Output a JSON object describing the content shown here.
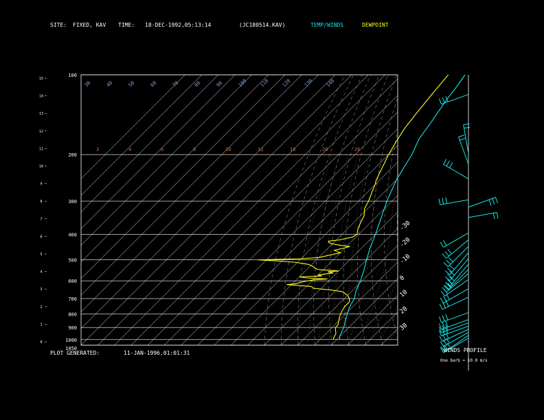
{
  "header": {
    "site_label": "SITE:",
    "site_value": "FIXED, KAV",
    "time_label": "TIME:",
    "time_value": "18-DEC-1992,05:13:14",
    "file_id": "(JC180514.KAV)",
    "legend_temp": "TEMP/WINDS",
    "legend_dew": "DEWPOINT",
    "legend_temp_color": "#19e6e6",
    "legend_dew_color": "#ffff19"
  },
  "footer": {
    "generated_label": "PLOT GENERATED:",
    "generated_value": "11-JAN-1996,01:01:31"
  },
  "winds_panel": {
    "title": "WINDS PROFILE",
    "note": "One barb = 10.0 m/s"
  },
  "chart_data": {
    "type": "line",
    "diagram": "skew-T log-p",
    "pressure_levels": [
      100,
      200,
      300,
      400,
      500,
      600,
      700,
      800,
      900,
      1000,
      1050
    ],
    "pressure_labels": [
      "100",
      "200",
      "300",
      "400",
      "500",
      "600",
      "700",
      "800",
      "900",
      "1000",
      "1050"
    ],
    "height_km_ticks": [
      "0",
      "1",
      "2",
      "3",
      "4",
      "5",
      "6",
      "7",
      "8",
      "9",
      "10",
      "11",
      "12",
      "13",
      "14",
      "15"
    ],
    "temperature_top_labels": [
      "-110",
      "-100",
      "-90",
      "-80",
      "-70",
      "-60",
      "-50",
      "-40"
    ],
    "temperature_right_labels": [
      "-30",
      "-20",
      "-10",
      "0",
      "10",
      "20",
      "30"
    ],
    "isotherm_range_c": [
      -150,
      40
    ],
    "mixing_ratio_labels": [
      "3",
      "4",
      "6",
      "8",
      "10",
      "12",
      "16",
      "20",
      "26"
    ],
    "theta_labels": [
      "30",
      "40",
      "50",
      "60",
      "70",
      "80",
      "90",
      "100",
      "110",
      "120",
      "130",
      "140"
    ],
    "series": [
      {
        "name": "TEMP/WINDS",
        "color": "#19e6e6",
        "points": [
          [
            1000,
            2
          ],
          [
            975,
            0
          ],
          [
            950,
            -1
          ],
          [
            925,
            -2
          ],
          [
            900,
            -3
          ],
          [
            850,
            -6
          ],
          [
            800,
            -9
          ],
          [
            750,
            -12
          ],
          [
            700,
            -14
          ],
          [
            650,
            -18
          ],
          [
            600,
            -21
          ],
          [
            550,
            -25
          ],
          [
            500,
            -30
          ],
          [
            450,
            -35
          ],
          [
            400,
            -40
          ],
          [
            350,
            -46
          ],
          [
            300,
            -53
          ],
          [
            250,
            -60
          ],
          [
            200,
            -66
          ],
          [
            175,
            -71
          ],
          [
            150,
            -74
          ],
          [
            125,
            -78
          ],
          [
            110,
            -80
          ],
          [
            100,
            -82
          ]
        ]
      },
      {
        "name": "DEWPOINT",
        "color": "#ffff19",
        "points": [
          [
            1000,
            -2
          ],
          [
            980,
            -3
          ],
          [
            950,
            -4
          ],
          [
            925,
            -6
          ],
          [
            900,
            -8
          ],
          [
            880,
            -8
          ],
          [
            850,
            -10
          ],
          [
            820,
            -12
          ],
          [
            800,
            -13
          ],
          [
            780,
            -14
          ],
          [
            750,
            -15
          ],
          [
            720,
            -15
          ],
          [
            700,
            -17
          ],
          [
            680,
            -20
          ],
          [
            660,
            -25
          ],
          [
            650,
            -33
          ],
          [
            640,
            -45
          ],
          [
            630,
            -47
          ],
          [
            625,
            -55
          ],
          [
            620,
            -63
          ],
          [
            615,
            -58
          ],
          [
            605,
            -55
          ],
          [
            595,
            -50
          ],
          [
            590,
            -42
          ],
          [
            585,
            -55
          ],
          [
            580,
            -60
          ],
          [
            575,
            -47
          ],
          [
            570,
            -50
          ],
          [
            560,
            -42
          ],
          [
            555,
            -46
          ],
          [
            550,
            -40
          ],
          [
            545,
            -52
          ],
          [
            540,
            -55
          ],
          [
            530,
            -58
          ],
          [
            520,
            -62
          ],
          [
            510,
            -72
          ],
          [
            505,
            -82
          ],
          [
            500,
            -95
          ],
          [
            495,
            -70
          ],
          [
            490,
            -60
          ],
          [
            480,
            -55
          ],
          [
            470,
            -50
          ],
          [
            460,
            -55
          ],
          [
            450,
            -50
          ],
          [
            445,
            -48
          ],
          [
            440,
            -55
          ],
          [
            435,
            -60
          ],
          [
            430,
            -63
          ],
          [
            425,
            -64
          ],
          [
            420,
            -58
          ],
          [
            410,
            -52
          ],
          [
            400,
            -51
          ],
          [
            380,
            -54
          ],
          [
            360,
            -56
          ],
          [
            340,
            -58
          ],
          [
            320,
            -62
          ],
          [
            300,
            -64
          ],
          [
            280,
            -67
          ],
          [
            260,
            -70
          ],
          [
            250,
            -72
          ],
          [
            230,
            -75
          ],
          [
            200,
            -80
          ],
          [
            180,
            -83
          ],
          [
            160,
            -86
          ],
          [
            140,
            -88
          ],
          [
            120,
            -90
          ],
          [
            110,
            -91
          ],
          [
            100,
            -92
          ]
        ]
      }
    ],
    "winds": [
      [
        1000,
        240,
        20
      ],
      [
        975,
        235,
        25
      ],
      [
        950,
        240,
        30
      ],
      [
        925,
        245,
        30
      ],
      [
        900,
        250,
        35
      ],
      [
        875,
        250,
        35
      ],
      [
        850,
        250,
        30
      ],
      [
        800,
        250,
        30
      ],
      [
        700,
        245,
        30
      ],
      [
        650,
        240,
        25
      ],
      [
        600,
        235,
        20
      ],
      [
        570,
        230,
        25
      ],
      [
        550,
        225,
        30
      ],
      [
        525,
        220,
        30
      ],
      [
        500,
        220,
        30
      ],
      [
        475,
        220,
        30
      ],
      [
        450,
        225,
        25
      ],
      [
        425,
        230,
        25
      ],
      [
        400,
        240,
        20
      ],
      [
        350,
        80,
        15
      ],
      [
        320,
        70,
        30
      ],
      [
        300,
        260,
        40
      ],
      [
        250,
        300,
        25
      ],
      [
        220,
        340,
        15
      ],
      [
        200,
        350,
        15
      ],
      [
        120,
        250,
        40
      ]
    ]
  }
}
